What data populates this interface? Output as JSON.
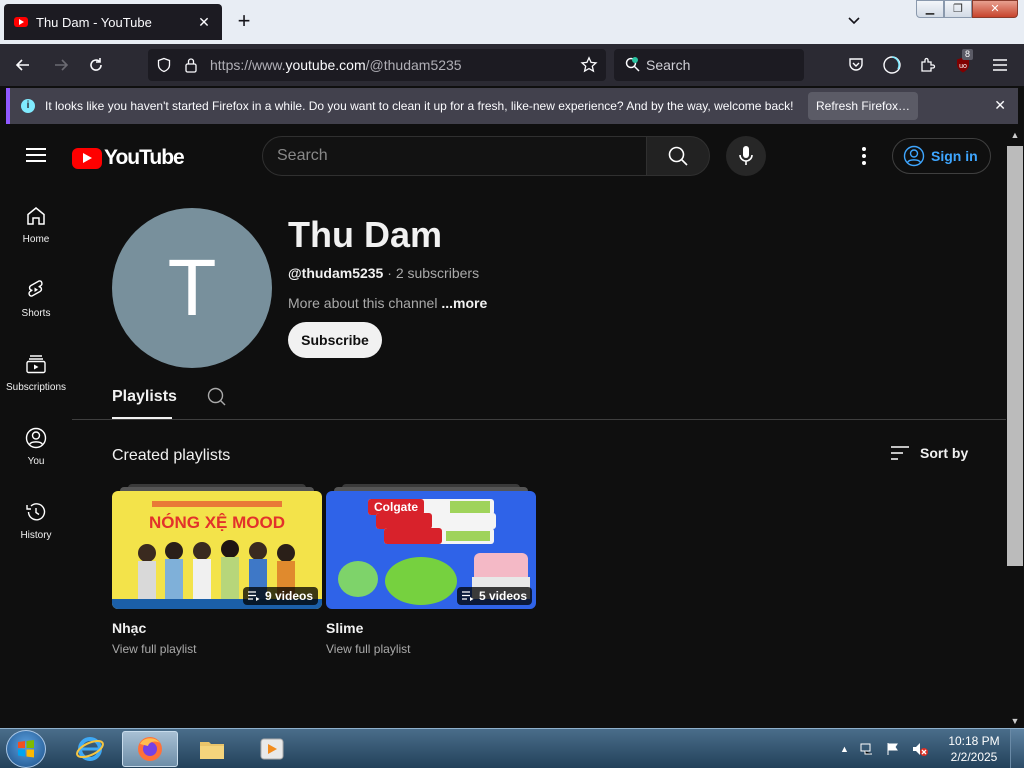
{
  "browser": {
    "tab_title": "Thu Dam - YouTube",
    "url_prefix": "https://www.",
    "url_host": "youtube.com",
    "url_path": "/@thudam5235",
    "search_placeholder": "Search",
    "extension_badge": "8",
    "notification": {
      "message": "It looks like you haven't started Firefox in a while. Do you want to clean it up for a fresh, like-new experience? And by the way, welcome back!",
      "button": "Refresh Firefox…"
    }
  },
  "youtube": {
    "logo_text": "YouTube",
    "search_placeholder": "Search",
    "sign_in": "Sign in",
    "guide": [
      "Home",
      "Shorts",
      "Subscriptions",
      "You",
      "History"
    ],
    "channel": {
      "avatar_letter": "T",
      "name": "Thu Dam",
      "handle": "@thudam5235",
      "separator": " · ",
      "subscribers": "2 subscribers",
      "description": "More about this channel",
      "more": " ...more",
      "subscribe": "Subscribe"
    },
    "tabs": {
      "active": "Playlists"
    },
    "section_title": "Created playlists",
    "sort_by": "Sort by",
    "playlists": [
      {
        "title": "Nhạc",
        "count": "9 videos",
        "link": "View full playlist",
        "thumb_text": "NÓNG XỆ MOOD"
      },
      {
        "title": "Slime",
        "count": "5 videos",
        "link": "View full playlist",
        "thumb_text": "Colgate"
      }
    ]
  },
  "taskbar": {
    "time": "10:18 PM",
    "date": "2/2/2025"
  },
  "colors": {
    "youtube_red": "#ff0000",
    "link_blue": "#3ea6ff",
    "firefox_dark": "#2b2a33",
    "avatar_gray": "#78909c"
  }
}
